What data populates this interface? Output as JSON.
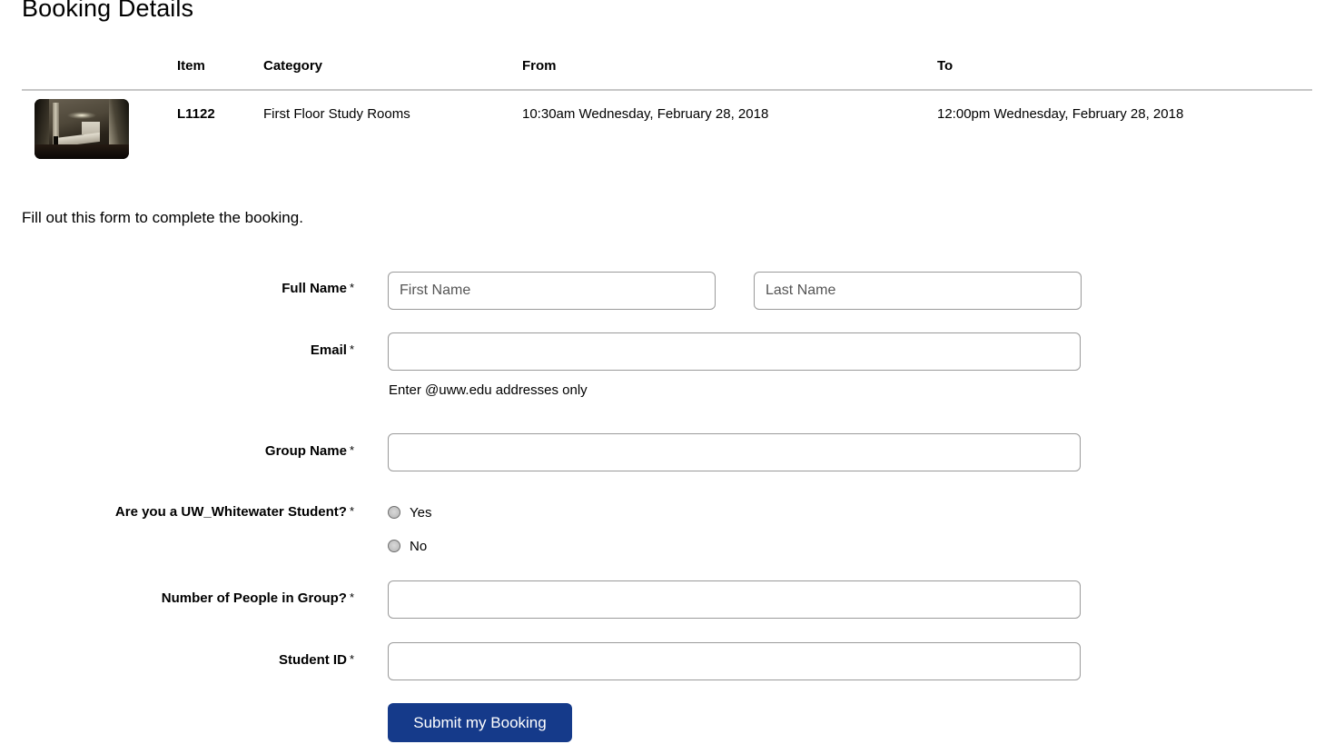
{
  "page": {
    "title": "Booking Details",
    "form_intro": "Fill out this form to complete the booking."
  },
  "booking_table": {
    "columns": {
      "thumbnail": "",
      "item": "Item",
      "category": "Category",
      "from": "From",
      "to": "To"
    },
    "rows": [
      {
        "thumbnail_alt": "study-room-photo",
        "item": "L1122",
        "category": "First Floor Study Rooms",
        "from": "10:30am Wednesday, February 28, 2018",
        "to": "12:00pm Wednesday, February 28, 2018"
      }
    ]
  },
  "form": {
    "full_name": {
      "label": "Full Name",
      "required_mark": "*",
      "first_name_placeholder": "First Name",
      "first_name_value": "",
      "last_name_placeholder": "Last Name",
      "last_name_value": ""
    },
    "email": {
      "label": "Email",
      "required_mark": "*",
      "value": "",
      "placeholder": "",
      "hint": "Enter @uww.edu addresses only"
    },
    "group_name": {
      "label": "Group Name",
      "required_mark": "*",
      "value": "",
      "placeholder": ""
    },
    "student_question": {
      "label": "Are you a UW_Whitewater Student?",
      "required_mark": "*",
      "options": [
        {
          "label": "Yes",
          "selected": false
        },
        {
          "label": "No",
          "selected": false
        }
      ]
    },
    "group_size": {
      "label": "Number of People in Group?",
      "required_mark": "*",
      "value": "",
      "placeholder": ""
    },
    "student_id": {
      "label": "Student ID",
      "required_mark": "*",
      "value": "",
      "placeholder": ""
    },
    "submit": {
      "label": "Submit my Booking"
    }
  },
  "colors": {
    "submit_button": "#153a8a",
    "separator": "#c6c6c6",
    "input_border": "#9a9a9a",
    "page_background": "#ffffff"
  }
}
